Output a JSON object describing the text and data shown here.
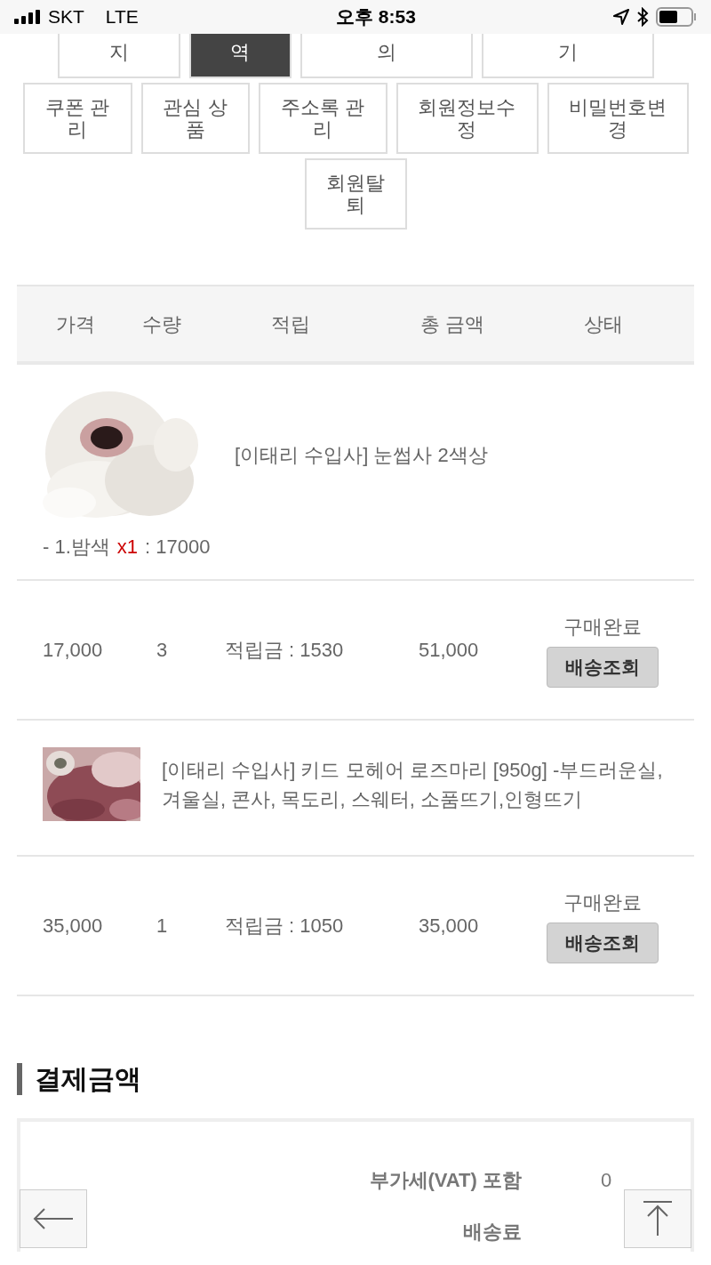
{
  "status_bar": {
    "carrier": "SKT",
    "network": "LTE",
    "time": "오후 8:53"
  },
  "menu_rows": [
    [
      {
        "label": "지",
        "selected": false
      },
      {
        "label": "역",
        "selected": true
      },
      {
        "label": "의",
        "selected": false
      },
      {
        "label": "기",
        "selected": false
      }
    ],
    [
      {
        "label": "쿠폰 관리",
        "selected": false
      },
      {
        "label": "관심 상품",
        "selected": false
      },
      {
        "label": "주소록 관리",
        "selected": false
      },
      {
        "label": "회원정보수정",
        "selected": false
      },
      {
        "label": "비밀번호변경",
        "selected": false
      }
    ],
    [
      {
        "label": "회원탈퇴",
        "selected": false
      }
    ]
  ],
  "table": {
    "columns": [
      "가격",
      "수량",
      "적립",
      "총 금액",
      "상태"
    ],
    "orders": [
      {
        "product": {
          "name": "[이태리 수입사] 눈썹사 2색상",
          "option": {
            "name": "- 1.밤색",
            "quantity": "x1",
            "price": ": 17000"
          }
        },
        "price": "17,000",
        "quantity": "3",
        "points": "적립금 : 1530",
        "total": "51,000",
        "status": "구매완료",
        "action": "배송조회"
      },
      {
        "product": {
          "name": "[이태리 수입사] 키드 모헤어 로즈마리 [950g] -부드러운실, 겨울실, 콘사, 목도리, 스웨터, 소품뜨기,인형뜨기"
        },
        "price": "35,000",
        "quantity": "1",
        "points": "적립금 : 1050",
        "total": "35,000",
        "status": "구매완료",
        "action": "배송조회"
      }
    ]
  },
  "payment": {
    "title": "결제금액",
    "rows": [
      {
        "label": "부가세(VAT) 포함",
        "value": "0"
      },
      {
        "label": "배송료"
      }
    ]
  }
}
